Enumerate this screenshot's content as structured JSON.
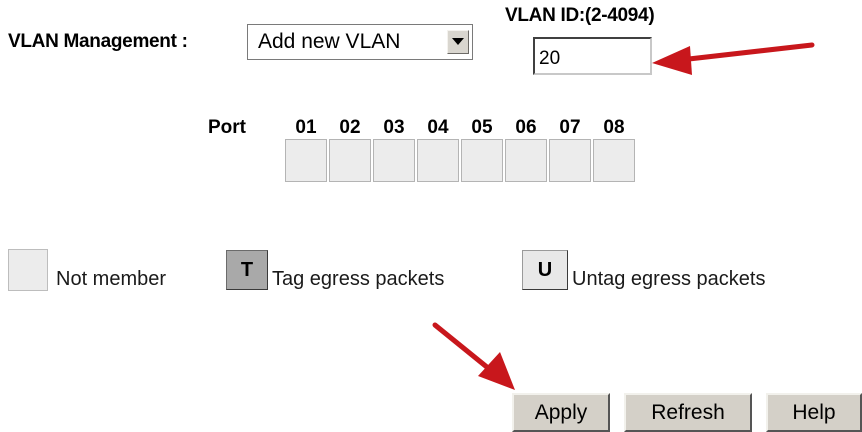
{
  "vlan_management": {
    "label": "VLAN Management :",
    "selected": "Add new VLAN"
  },
  "vlan_id": {
    "label": "VLAN ID:(2-4094)",
    "value": "20"
  },
  "ports": {
    "label": "Port",
    "numbers": [
      "01",
      "02",
      "03",
      "04",
      "05",
      "06",
      "07",
      "08"
    ]
  },
  "legend": {
    "not_member": "Not member",
    "tag_symbol": "T",
    "tag_text": "Tag egress packets",
    "untag_symbol": "U",
    "untag_text": "Untag egress packets"
  },
  "buttons": {
    "apply": "Apply",
    "refresh": "Refresh",
    "help": "Help"
  },
  "colors": {
    "annotation_arrow": "#c8171c",
    "button_face": "#d4d0c8"
  }
}
